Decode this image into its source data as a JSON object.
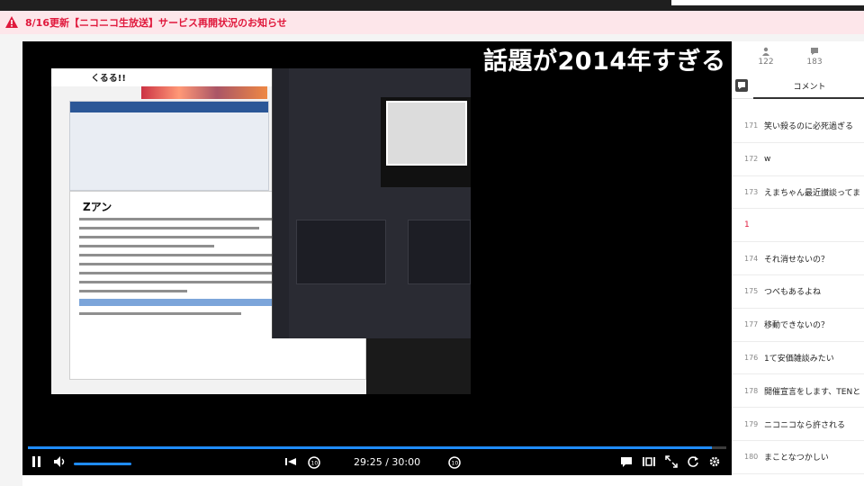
{
  "notice": {
    "text": "8/16更新【ニコニコ生放送】サービス再開状況のお知らせ",
    "color": "#e0183c"
  },
  "video": {
    "overlay_title": "話題が2014年すぎる",
    "embedded": {
      "doc_heading": "くるる!!",
      "page_heading": "Zアン"
    },
    "progress_fraction": 0.979,
    "volume_fraction": 0.8,
    "time_text": "29:25 / 30:00",
    "icons": [
      "pause-icon",
      "volume-icon",
      "skip-to-start-icon",
      "rewind-10-icon",
      "forward-10-icon",
      "comment-icon",
      "fullscreen-comment-icon",
      "expand-icon",
      "reload-icon",
      "settings-icon"
    ],
    "accent": "#1f8cff"
  },
  "stats": {
    "viewers": "122",
    "comments": "183"
  },
  "comment_tab": {
    "label": "コメント"
  },
  "comments": [
    {
      "no": "171",
      "text": "笑い殺るのに必死過ぎる"
    },
    {
      "no": "172",
      "text": "w"
    },
    {
      "no": "173",
      "text": "えまちゃん最近讃談ってま"
    },
    {
      "no": "1",
      "text": "",
      "highlight": true
    },
    {
      "no": "174",
      "text": "それ消せないの？"
    },
    {
      "no": "175",
      "text": "つべもあるよね"
    },
    {
      "no": "177",
      "text": "移動できないの？"
    },
    {
      "no": "176",
      "text": "1て安価雑談みたい"
    },
    {
      "no": "178",
      "text": "開催宣言をします、TENと"
    },
    {
      "no": "179",
      "text": "ニコニコなら許される"
    },
    {
      "no": "180",
      "text": "まことなつかしい"
    }
  ]
}
